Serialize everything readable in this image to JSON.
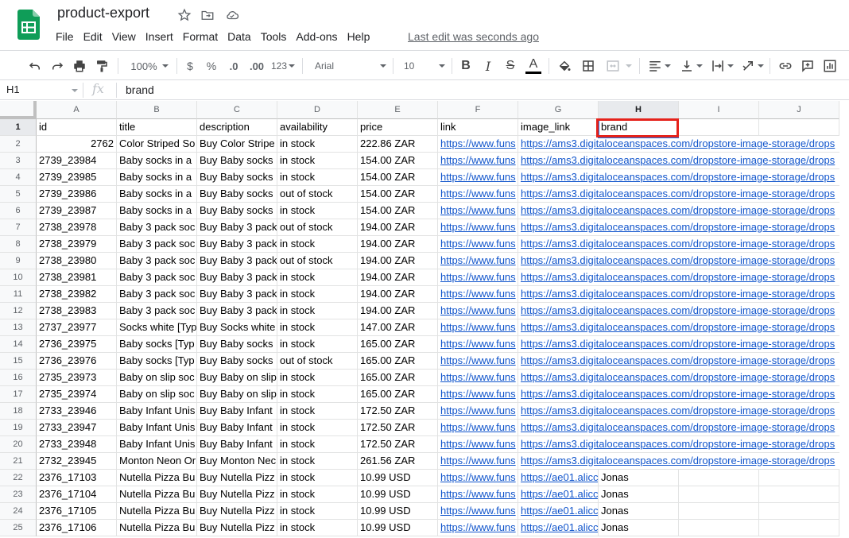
{
  "app": {
    "doc_title": "product-export",
    "menu": [
      "File",
      "Edit",
      "View",
      "Insert",
      "Format",
      "Data",
      "Tools",
      "Add-ons",
      "Help"
    ],
    "last_edit": "Last edit was seconds ago",
    "icons": {
      "logo": "sheets-logo-icon",
      "star": "star-icon",
      "move": "folder-move-icon",
      "cloud": "cloud-status-icon"
    },
    "brand_color": "#0f9d58"
  },
  "toolbar": {
    "zoom": "100%",
    "currency": "$",
    "percent": "%",
    "dec_decrease": ".0",
    "dec_increase": ".00",
    "more_formats": "123",
    "font": "Arial",
    "font_size": "10",
    "bold": "B",
    "italic": "I",
    "strike": "S",
    "text_color": "A"
  },
  "formula_bar": {
    "cell_ref": "H1",
    "fx": "fx",
    "value": "brand"
  },
  "grid": {
    "columns": [
      "A",
      "B",
      "C",
      "D",
      "E",
      "F",
      "G",
      "H",
      "I",
      "J"
    ],
    "selected_column": "H",
    "selected_row": 1,
    "highlight_color": "#e5221b",
    "header": [
      "id",
      "title",
      "description",
      "availability",
      "price",
      "link",
      "image_link",
      "brand",
      "",
      ""
    ],
    "rows": [
      [
        "2762",
        "Color Striped So",
        "Buy Color Stripe",
        "in stock",
        "222.86 ZAR",
        "https://www.funs",
        "https://ams3.digitaloceanspaces.com/dropstore-image-storage/drops",
        "",
        "",
        ""
      ],
      [
        "2739_23984",
        "Baby socks in a",
        "Buy Baby socks",
        "in stock",
        "154.00 ZAR",
        "https://www.funs",
        "https://ams3.digitaloceanspaces.com/dropstore-image-storage/drops",
        "",
        "",
        ""
      ],
      [
        "2739_23985",
        "Baby socks in a",
        "Buy Baby socks",
        "in stock",
        "154.00 ZAR",
        "https://www.funs",
        "https://ams3.digitaloceanspaces.com/dropstore-image-storage/drops",
        "",
        "",
        ""
      ],
      [
        "2739_23986",
        "Baby socks in a",
        "Buy Baby socks",
        "out of stock",
        "154.00 ZAR",
        "https://www.funs",
        "https://ams3.digitaloceanspaces.com/dropstore-image-storage/drops",
        "",
        "",
        ""
      ],
      [
        "2739_23987",
        "Baby socks in a",
        "Buy Baby socks",
        "in stock",
        "154.00 ZAR",
        "https://www.funs",
        "https://ams3.digitaloceanspaces.com/dropstore-image-storage/drops",
        "",
        "",
        ""
      ],
      [
        "2738_23978",
        "Baby 3 pack soc",
        "Buy Baby 3 pack",
        "out of stock",
        "194.00 ZAR",
        "https://www.funs",
        "https://ams3.digitaloceanspaces.com/dropstore-image-storage/drops",
        "",
        "",
        ""
      ],
      [
        "2738_23979",
        "Baby 3 pack soc",
        "Buy Baby 3 pack",
        "in stock",
        "194.00 ZAR",
        "https://www.funs",
        "https://ams3.digitaloceanspaces.com/dropstore-image-storage/drops",
        "",
        "",
        ""
      ],
      [
        "2738_23980",
        "Baby 3 pack soc",
        "Buy Baby 3 pack",
        "out of stock",
        "194.00 ZAR",
        "https://www.funs",
        "https://ams3.digitaloceanspaces.com/dropstore-image-storage/drops",
        "",
        "",
        ""
      ],
      [
        "2738_23981",
        "Baby 3 pack soc",
        "Buy Baby 3 pack",
        "in stock",
        "194.00 ZAR",
        "https://www.funs",
        "https://ams3.digitaloceanspaces.com/dropstore-image-storage/drops",
        "",
        "",
        ""
      ],
      [
        "2738_23982",
        "Baby 3 pack soc",
        "Buy Baby 3 pack",
        "in stock",
        "194.00 ZAR",
        "https://www.funs",
        "https://ams3.digitaloceanspaces.com/dropstore-image-storage/drops",
        "",
        "",
        ""
      ],
      [
        "2738_23983",
        "Baby 3 pack soc",
        "Buy Baby 3 pack",
        "in stock",
        "194.00 ZAR",
        "https://www.funs",
        "https://ams3.digitaloceanspaces.com/dropstore-image-storage/drops",
        "",
        "",
        ""
      ],
      [
        "2737_23977",
        "Socks white [Typ",
        "Buy Socks white",
        "in stock",
        "147.00 ZAR",
        "https://www.funs",
        "https://ams3.digitaloceanspaces.com/dropstore-image-storage/drops",
        "",
        "",
        ""
      ],
      [
        "2736_23975",
        "Baby socks [Typ",
        "Buy Baby socks",
        "in stock",
        "165.00 ZAR",
        "https://www.funs",
        "https://ams3.digitaloceanspaces.com/dropstore-image-storage/drops",
        "",
        "",
        ""
      ],
      [
        "2736_23976",
        "Baby socks [Typ",
        "Buy Baby socks",
        "out of stock",
        "165.00 ZAR",
        "https://www.funs",
        "https://ams3.digitaloceanspaces.com/dropstore-image-storage/drops",
        "",
        "",
        ""
      ],
      [
        "2735_23973",
        "Baby on slip soc",
        "Buy Baby on slip",
        "in stock",
        "165.00 ZAR",
        "https://www.funs",
        "https://ams3.digitaloceanspaces.com/dropstore-image-storage/drops",
        "",
        "",
        ""
      ],
      [
        "2735_23974",
        "Baby on slip soc",
        "Buy Baby on slip",
        "in stock",
        "165.00 ZAR",
        "https://www.funs",
        "https://ams3.digitaloceanspaces.com/dropstore-image-storage/drops",
        "",
        "",
        ""
      ],
      [
        "2733_23946",
        "Baby Infant Unis",
        "Buy Baby Infant",
        "in stock",
        "172.50 ZAR",
        "https://www.funs",
        "https://ams3.digitaloceanspaces.com/dropstore-image-storage/drops",
        "",
        "",
        ""
      ],
      [
        "2733_23947",
        "Baby Infant Unis",
        "Buy Baby Infant",
        "in stock",
        "172.50 ZAR",
        "https://www.funs",
        "https://ams3.digitaloceanspaces.com/dropstore-image-storage/drops",
        "",
        "",
        ""
      ],
      [
        "2733_23948",
        "Baby Infant Unis",
        "Buy Baby Infant",
        "in stock",
        "172.50 ZAR",
        "https://www.funs",
        "https://ams3.digitaloceanspaces.com/dropstore-image-storage/drops",
        "",
        "",
        ""
      ],
      [
        "2732_23945",
        "Monton Neon Or",
        "Buy Monton Nec",
        "in stock",
        "261.56 ZAR",
        "https://www.funs",
        "https://ams3.digitaloceanspaces.com/dropstore-image-storage/drops",
        "",
        "",
        ""
      ],
      [
        "2376_17103",
        "Nutella Pizza Bu",
        "Buy Nutella Pizz",
        "in stock",
        "10.99 USD",
        "https://www.funs",
        "https://ae01.alicc",
        "Jonas",
        "",
        ""
      ],
      [
        "2376_17104",
        "Nutella Pizza Bu",
        "Buy Nutella Pizz",
        "in stock",
        "10.99 USD",
        "https://www.funs",
        "https://ae01.alicc",
        "Jonas",
        "",
        ""
      ],
      [
        "2376_17105",
        "Nutella Pizza Bu",
        "Buy Nutella Pizz",
        "in stock",
        "10.99 USD",
        "https://www.funs",
        "https://ae01.alicc",
        "Jonas",
        "",
        ""
      ],
      [
        "2376_17106",
        "Nutella Pizza Bu",
        "Buy Nutella Pizz",
        "in stock",
        "10.99 USD",
        "https://www.funs",
        "https://ae01.alicc",
        "Jonas",
        "",
        ""
      ]
    ]
  }
}
